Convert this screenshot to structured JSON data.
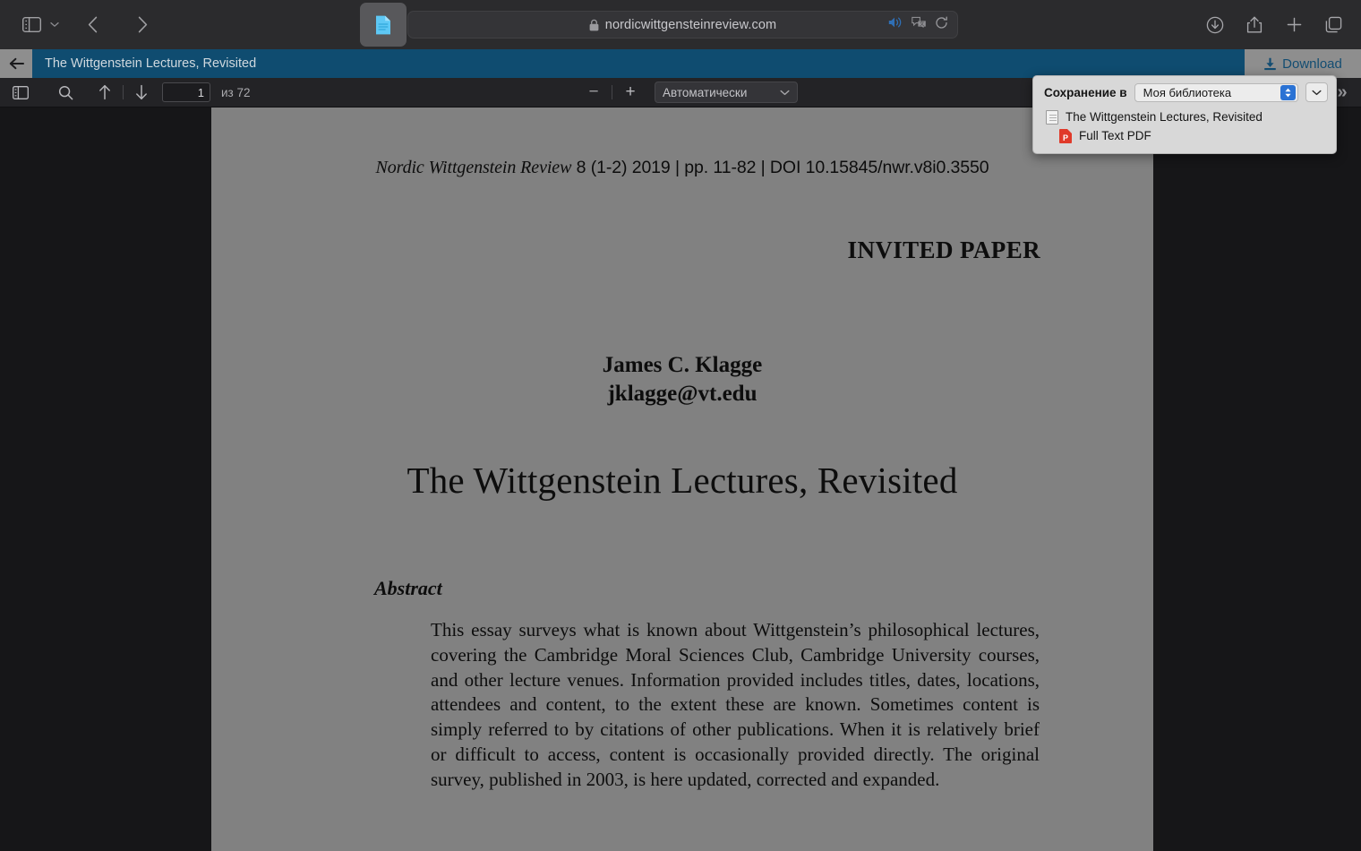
{
  "browser": {
    "url": "nordicwittgensteinreview.com",
    "lock_icon": "lock-icon",
    "sidebar_icon": "sidebar-toggle-icon",
    "back_label": "back-icon",
    "forward_label": "forward-icon",
    "tab_icon": "document-tab-icon",
    "speaker_icon": "speaker-icon",
    "translate_icon": "translate-icon",
    "reload_icon": "reload-icon",
    "downloads_icon": "downloads-icon",
    "share_icon": "share-icon",
    "new_tab_icon": "plus-icon",
    "tab_overview_icon": "tab-overview-icon"
  },
  "doc_titlebar": {
    "back_icon": "back-arrow-icon",
    "title": "The Wittgenstein Lectures, Revisited",
    "download_label": "Download",
    "download_icon": "download-icon",
    "bar_color": "#0f4c70"
  },
  "pdf_toolbar": {
    "sidebar_icon": "pdf-sidebar-toggle-icon",
    "search_icon": "search-icon",
    "prev_icon": "arrow-up-icon",
    "next_icon": "arrow-down-icon",
    "page_value": "1",
    "page_total": "из 72",
    "zoom_out_label": "−",
    "zoom_in_label": "+",
    "zoom_level": "Автоматически",
    "zoom_chevron_icon": "chevron-down-icon",
    "overflow_label": "»"
  },
  "zotero_popup": {
    "save_to_label": "Сохранение в",
    "library_value": "Моя библиотека",
    "stepper_icon": "stepper-up-down-icon",
    "dropdown_icon": "chevron-down-icon",
    "items": [
      {
        "icon": "document-icon",
        "label": "The Wittgenstein Lectures, Revisited",
        "indented": false
      },
      {
        "icon": "pdf-icon",
        "label": "Full Text PDF",
        "indented": true
      }
    ]
  },
  "pdf_page": {
    "citation": {
      "journal": "Nordic Wittgenstein Review",
      "rest": " 8 (1-2) 2019 | pp. 11-82 | DOI 10.15845/nwr.v8i0.3550"
    },
    "invited_paper": "INVITED PAPER",
    "author_name": "James C. Klagge",
    "author_email": "jklagge@vt.edu",
    "title": "The Wittgenstein Lectures, Revisited",
    "abstract_label": "Abstract",
    "abstract_body": "This essay surveys what is known about Wittgenstein’s philosophical lectures, covering the Cambridge Moral Sciences Club, Cambridge University courses, and other lecture venues.  Information provided includes titles, dates, locations, attendees and content, to the extent these are known.  Sometimes content is simply referred to by citations of other publications.  When it is relatively brief or difficult to access, content is occasionally provided directly.  The original survey, published in 2003, is here updated, corrected and expanded."
  }
}
